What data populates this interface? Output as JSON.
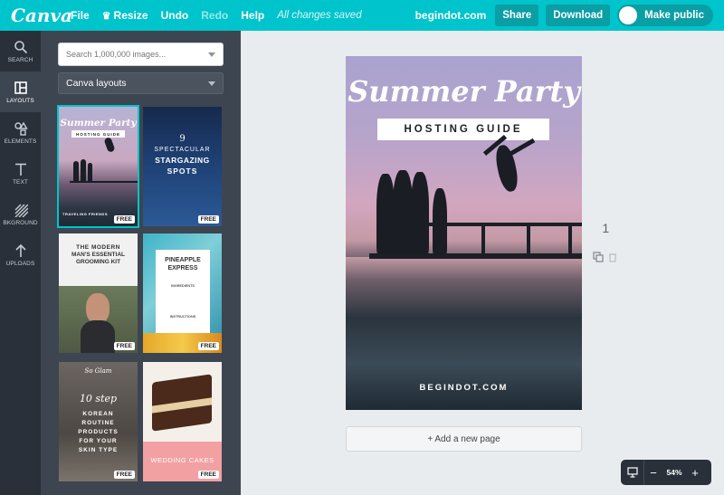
{
  "topbar": {
    "logo": "Canva",
    "file": "File",
    "resize": "Resize",
    "undo": "Undo",
    "redo": "Redo",
    "help": "Help",
    "saved": "All changes saved",
    "domain": "begindot.com",
    "share": "Share",
    "download": "Download",
    "make_public": "Make public"
  },
  "rail": {
    "search": "SEARCH",
    "layouts": "LAYOUTS",
    "elements": "ELEMENTS",
    "text": "TEXT",
    "background": "BKGROUND",
    "uploads": "UPLOADS"
  },
  "panel": {
    "search_placeholder": "Search 1,000,000 images...",
    "select_value": "Canva layouts",
    "free_label": "FREE",
    "thumbs": {
      "t1_title": "Summer Party",
      "t1_sub": "HOSTING GUIDE",
      "t1_footer": "TRAVELING FRIENDS",
      "t2_line1": "9",
      "t2_line2": "SPECTACULAR",
      "t2_line3": "STARGAZING",
      "t2_line4": "SPOTS",
      "t3_line1": "THE MODERN",
      "t3_line2": "MAN'S ESSENTIAL",
      "t3_line3": "GROOMING KIT",
      "t4_line1": "PINEAPPLE",
      "t4_line2": "EXPRESS",
      "t4_line3": "INGREDIENTS",
      "t4_line4": "INSTRUCTIONS",
      "t5_line1": "So Glam",
      "t5_line2": "10 step",
      "t5_line3": "KOREAN",
      "t5_line4": "ROUTINE",
      "t5_line5": "PRODUCTS",
      "t5_line6": "FOR YOUR",
      "t5_line7": "SKIN TYPE",
      "t6_line1": "WEDDING CAKES"
    }
  },
  "canvas": {
    "title": "Summer Party",
    "subtitle": "HOSTING GUIDE",
    "brand": "BEGINDOT.COM",
    "page_number": "1",
    "add_page": "+ Add a new page"
  },
  "zoom": {
    "minus": "−",
    "level": "54%",
    "plus": "+"
  },
  "colors": {
    "brand": "#00c4cc",
    "rail": "#293039",
    "panel": "#3d4550"
  }
}
